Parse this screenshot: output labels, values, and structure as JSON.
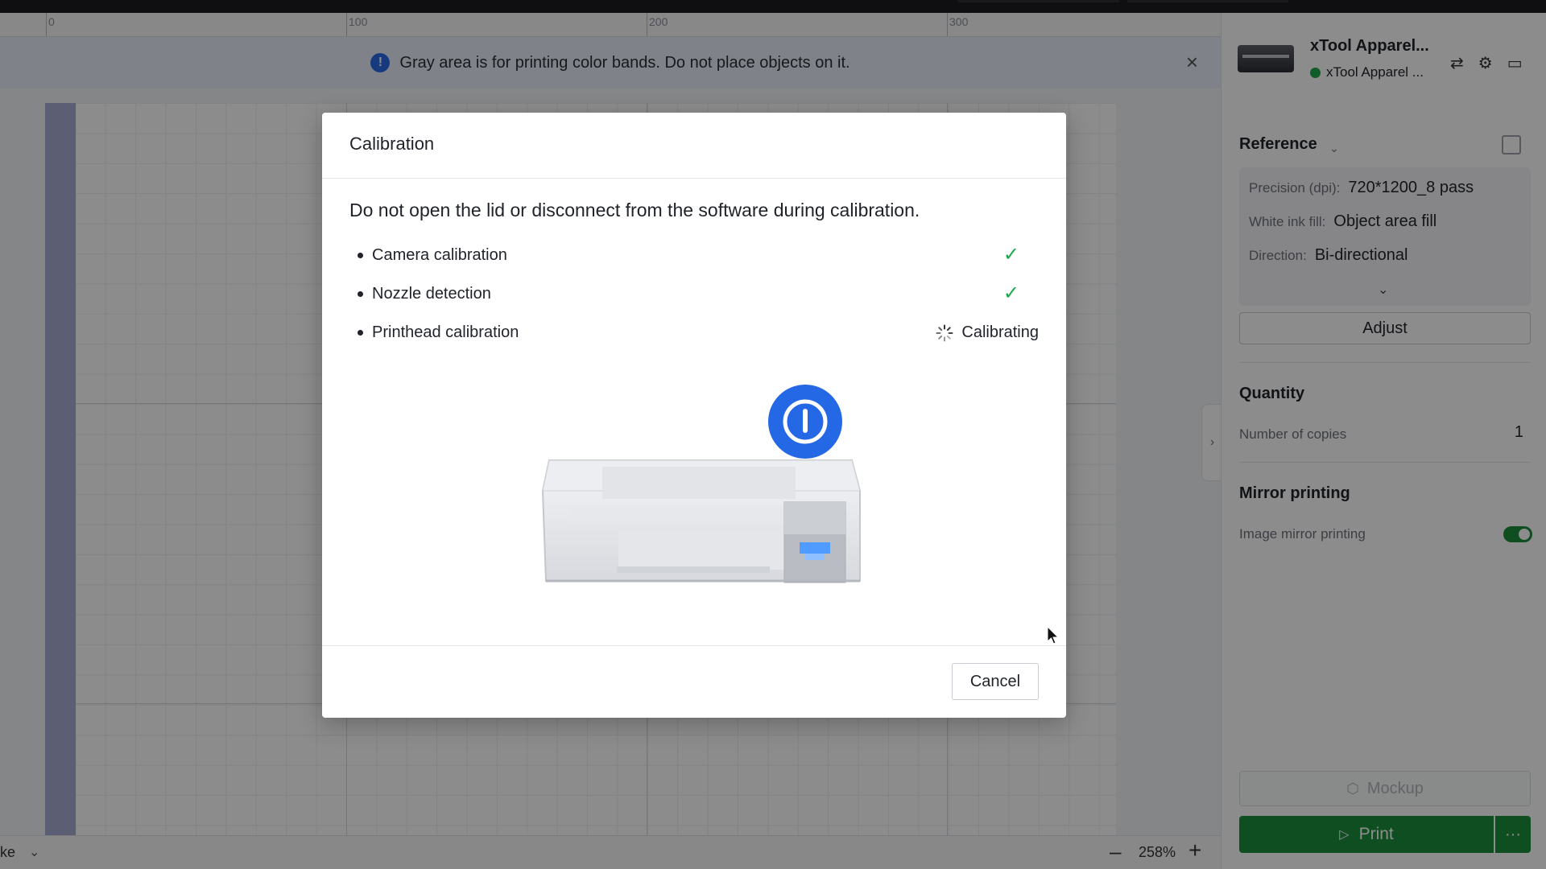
{
  "banner": {
    "message": "Gray area is for printing color bands. Do not place objects on it.",
    "icon": "info-icon",
    "close_icon": "close-icon"
  },
  "ruler": {
    "labels": [
      "0",
      "100",
      "200",
      "300"
    ]
  },
  "status_bar": {
    "left_text": "ke",
    "zoom_level": "258%",
    "zoom_out": "–",
    "zoom_in": "+"
  },
  "device": {
    "name": "xTool Apparel...",
    "status_text": "xTool Apparel ...",
    "status_color": "#1fa84b"
  },
  "panel": {
    "reference": {
      "title": "Reference",
      "rows": [
        {
          "key": "Precision (dpi):",
          "value": "720*1200_8 pass"
        },
        {
          "key": "White ink fill:",
          "value": "Object area fill"
        },
        {
          "key": "Direction:",
          "value": "Bi-directional"
        }
      ],
      "adjust_label": "Adjust"
    },
    "quantity": {
      "title": "Quantity",
      "copies_label": "Number of copies",
      "copies_value": "1"
    },
    "mirror": {
      "title": "Mirror printing",
      "option_label": "Image mirror printing",
      "enabled": true
    },
    "mockup_label": "Mockup",
    "print_label": "Print",
    "more_label": "···",
    "accent_color": "#1c8f3d"
  },
  "modal": {
    "title": "Calibration",
    "warning": "Do not open the lid or disconnect from the software during calibration.",
    "steps": [
      {
        "label": "Camera calibration",
        "state": "done"
      },
      {
        "label": "Nozzle detection",
        "state": "done"
      },
      {
        "label": "Printhead calibration",
        "state": "in-progress",
        "status_text": "Calibrating"
      }
    ],
    "cancel_label": "Cancel"
  }
}
